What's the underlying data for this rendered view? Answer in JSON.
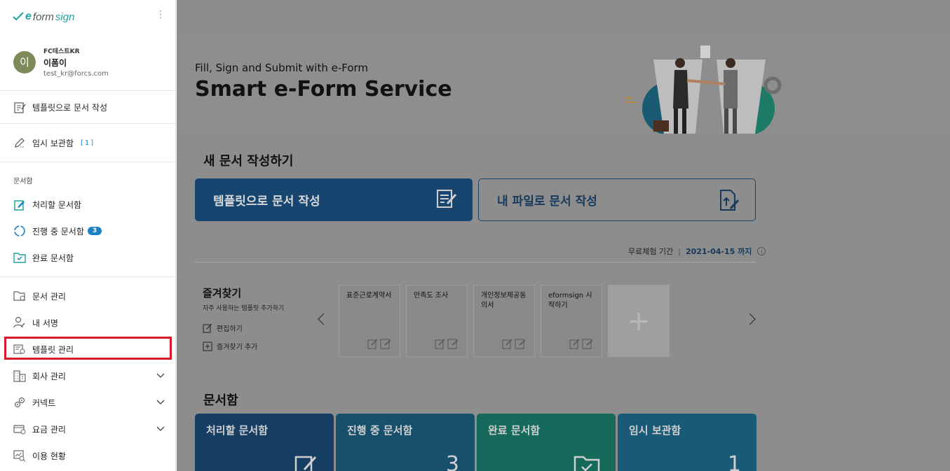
{
  "sidebar": {
    "logo": {
      "e": "e",
      "form": "form",
      "sign": "sign"
    },
    "kebab": "⋮",
    "profile": {
      "avatar_letter": "이",
      "company": "FC테스트KR",
      "name": "이폼이",
      "email": "test_kr@forcs.com"
    },
    "create_template": "템플릿으로 문서 작성",
    "drafts": {
      "label": "임시 보관함",
      "count": "[1]"
    },
    "documents_section": "문서함",
    "inbox": "처리할 문서함",
    "in_progress": {
      "label": "진행 중 문서함",
      "badge": "3"
    },
    "completed": "완료 문서함",
    "doc_manage": "문서 관리",
    "my_signature": "내 서명",
    "template_manage": "템플릿 관리",
    "company_manage": "회사 관리",
    "connect": "커넥트",
    "billing": "요금 관리",
    "usage": "이용 현황"
  },
  "hero": {
    "subtitle": "Fill, Sign and Submit with e-Form",
    "title": "Smart e-Form Service"
  },
  "new_doc": {
    "heading": "새 문서 작성하기",
    "template_button": "템플릿으로 문서 작성",
    "file_button": "내 파일로 문서 작성"
  },
  "trial": {
    "label": "무료체험 기간",
    "separator": "|",
    "date": "2021-04-15 까지",
    "info": "i"
  },
  "favorites": {
    "title": "즐겨찾기",
    "subtitle": "자주 사용하는 템플릿 추가하기",
    "edit": "편집하기",
    "add": "즐겨찾기 추가",
    "cards": [
      "표준근로계약서",
      "만족도 조사",
      "개인정보제공동의서",
      "eformsign 시작하기"
    ],
    "add_card": "+"
  },
  "boxes": {
    "heading": "문서함",
    "tiles": [
      {
        "label": "처리할 문서함",
        "value": ""
      },
      {
        "label": "진행 중 문서함",
        "value": "3"
      },
      {
        "label": "완료 문서함",
        "value": ""
      },
      {
        "label": "임시 보관함",
        "value": "1"
      }
    ]
  },
  "colors": {
    "accent": "#1a82c4",
    "brand": "#1fa29a",
    "primary_button": "#164570",
    "highlight": "#d7192a"
  }
}
